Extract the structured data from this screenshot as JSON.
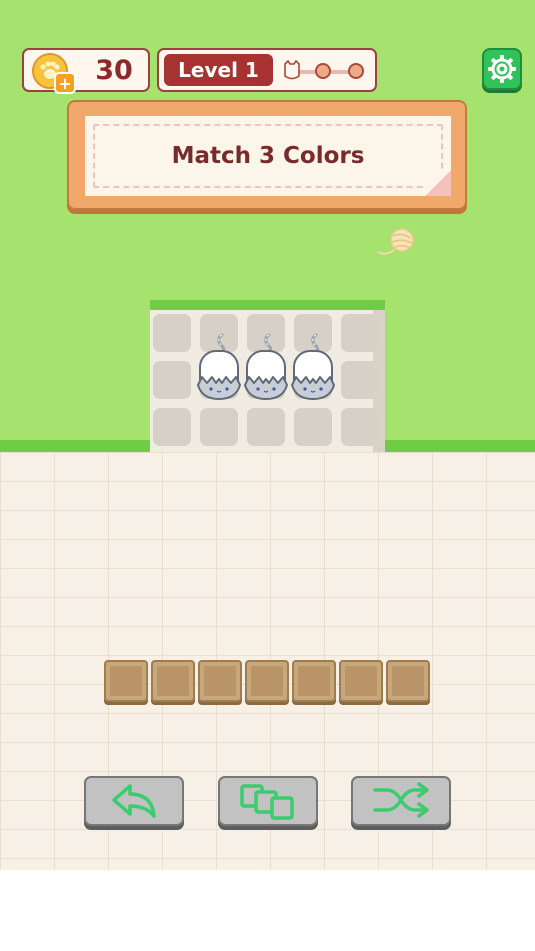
{
  "hud": {
    "coins": "30",
    "level_label": "Level 1",
    "level_progress_dots": 2
  },
  "banner": {
    "text": "Match 3 Colors"
  },
  "board": {
    "rows": 3,
    "cols": 5,
    "cats": [
      {
        "row": 1,
        "col": 1,
        "color": "white"
      },
      {
        "row": 1,
        "col": 2,
        "color": "white"
      },
      {
        "row": 1,
        "col": 3,
        "color": "white"
      }
    ]
  },
  "tray": {
    "slots": 7,
    "filled": 0
  },
  "actions": [
    {
      "name": "undo",
      "icon": "undo-arrow-icon"
    },
    {
      "name": "stack",
      "icon": "stack-squares-icon"
    },
    {
      "name": "shuffle",
      "icon": "shuffle-icon"
    }
  ],
  "colors": {
    "grass": "#a6e36e",
    "grass_edge": "#6fcd45",
    "accent_red": "#a83232",
    "icon_green": "#3bcc6e",
    "banner_orange": "#f0a96a"
  }
}
